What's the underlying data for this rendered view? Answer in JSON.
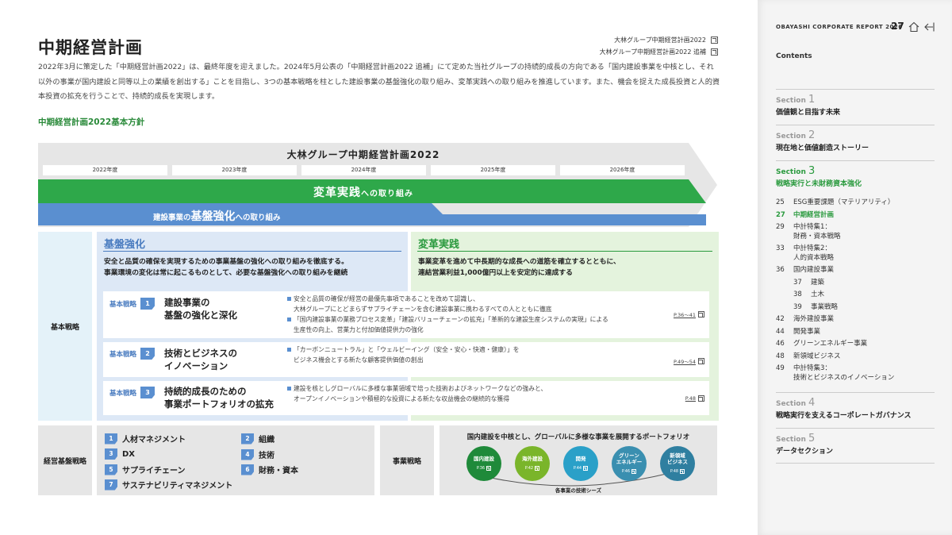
{
  "header": {
    "title": "中期経営計画",
    "links": [
      "大林グループ中期経営計画2022",
      "大林グループ中期経営計画2022 追補"
    ],
    "intro": "2022年3月に策定した「中期経営計画2022」は、最終年度を迎えました。2024年5月公表の「中期経営計画2022 追補」にて定めた当社グループの持続的成長の方向である「国内建設事業を中核とし、それ以外の事業が国内建設と同等以上の業績を創出する」ことを目指し、3つの基本戦略を柱とした建設事業の基盤強化の取り組み、変革実践への取り組みを推進しています。また、機会を捉えた成長投資と人的資本投資の拡充を行うことで、持続的成長を実現します。",
    "policy_heading": "中期経営計画2022基本方針"
  },
  "plan": {
    "title": "大林グループ中期経営計画2022",
    "years": [
      "2022年度",
      "2023年度",
      "2024年度",
      "2025年度",
      "2026年度"
    ],
    "green_band_main": "変革実践",
    "green_band_suffix": "への取り組み",
    "blue_band_prefix": "建設事業の",
    "blue_band_main": "基盤強化",
    "blue_band_suffix": "への取り組み"
  },
  "basic_strategy": {
    "label": "基本戦略",
    "kiban": {
      "title": "基盤強化",
      "text1": "安全と品質の確保を実現するための事業基盤の強化への取り組みを徹底する。",
      "text2": "事業環境の変化は常に起こるものとして、必要な基盤強化への取り組みを継続"
    },
    "henkaku": {
      "title": "変革実践",
      "text1": "事業変革を進めて中長期的な成長への道筋を確立するとともに、",
      "text2": "連結営業利益1,000億円以上を安定的に達成する"
    },
    "tag_label": "基本戦略",
    "items": [
      {
        "num": "1",
        "name1": "建設事業の",
        "name2": "基盤の強化と深化",
        "desc1a": "安全と品質の確保が経営の最優先事項であることを改めて認識し、",
        "desc1b": "大林グループにとどまらずサプライチェーンを含む建設事業に携わるすべての人とともに徹底",
        "desc2a": "「国内建設事業の業務プロセス変革」「建設バリューチェーンの拡充」「革新的な建設生産システムの実現」による",
        "desc2b": "生産性の向上、営業力と付加価値提供力の強化",
        "page": "P.36～41"
      },
      {
        "num": "2",
        "name1": "技術とビジネスの",
        "name2": "イノベーション",
        "desc1a": "「カーボンニュートラル」と「ウェルビーイング（安全・安心・快適・健康）」を",
        "desc1b": "ビジネス機会とする新たな顧客提供価値の創出",
        "page": "P.49～54"
      },
      {
        "num": "3",
        "name1": "持続的成長のための",
        "name2": "事業ポートフォリオの拡充",
        "desc1a": "建設を核としグローバルに多様な事業領域で培った技術およびネットワークなどの強みと、",
        "desc1b": "オープンイノベーションや積極的な投資による新たな収益機会の継続的な獲得",
        "page": "P.48"
      }
    ]
  },
  "management": {
    "label": "経営基盤戦略",
    "items": [
      {
        "num": "1",
        "label": "人材マネジメント"
      },
      {
        "num": "2",
        "label": "組織"
      },
      {
        "num": "3",
        "label": "DX"
      },
      {
        "num": "4",
        "label": "技術"
      },
      {
        "num": "5",
        "label": "サプライチェーン"
      },
      {
        "num": "6",
        "label": "財務・資本"
      },
      {
        "num": "7",
        "label": "サステナビリティマネジメント"
      }
    ]
  },
  "business": {
    "label": "事業戦略",
    "title": "国内建設を中核とし、グローバルに多様な事業を展開するポートフォリオ",
    "circles": [
      {
        "name1": "国内建設",
        "name2": "",
        "page": "P.36",
        "color": "#1f8a3a"
      },
      {
        "name1": "海外建設",
        "name2": "",
        "page": "P.42",
        "color": "#7ab52a"
      },
      {
        "name1": "開発",
        "name2": "",
        "page": "P.44",
        "color": "#2aa0c8"
      },
      {
        "name1": "グリーン",
        "name2": "エネルギー",
        "page": "P.46",
        "color": "#3a8fb0"
      },
      {
        "name1": "新領域",
        "name2": "ビジネス",
        "page": "P.48",
        "color": "#2f7fa0"
      }
    ],
    "seeds": "各事業の技術シーズ"
  },
  "sidebar": {
    "report_name": "OBAYASHI CORPORATE REPORT 2026",
    "page_num": "27",
    "contents": "Contents",
    "sections": [
      {
        "label": "Section",
        "num": "1",
        "title": "価値観と目指す未来"
      },
      {
        "label": "Section",
        "num": "2",
        "title": "現在地と価値創造ストーリー"
      },
      {
        "label": "Section",
        "num": "3",
        "title": "戦略実行と未財務資本強化"
      },
      {
        "label": "Section",
        "num": "4",
        "title": "戦略実行を支えるコーポレートガバナンス"
      },
      {
        "label": "Section",
        "num": "5",
        "title": "データセクション"
      }
    ],
    "toc": [
      {
        "pg": "25",
        "label": "ESG重要課題（マテリアリティ）"
      },
      {
        "pg": "27",
        "label": "中期経営計画"
      },
      {
        "pg": "29",
        "label": "中計特集1：",
        "label2": "財務・資本戦略"
      },
      {
        "pg": "33",
        "label": "中計特集2：",
        "label2": "人的資本戦略"
      },
      {
        "pg": "36",
        "label": "国内建設事業"
      },
      {
        "pg": "37",
        "label": "建築"
      },
      {
        "pg": "38",
        "label": "土木"
      },
      {
        "pg": "39",
        "label": "事業戦略"
      },
      {
        "pg": "42",
        "label": "海外建設事業"
      },
      {
        "pg": "44",
        "label": "開発事業"
      },
      {
        "pg": "46",
        "label": "グリーンエネルギー事業"
      },
      {
        "pg": "48",
        "label": "新領域ビジネス"
      },
      {
        "pg": "49",
        "label": "中計特集3：",
        "label2": "技術とビジネスのイノベーション"
      }
    ]
  }
}
